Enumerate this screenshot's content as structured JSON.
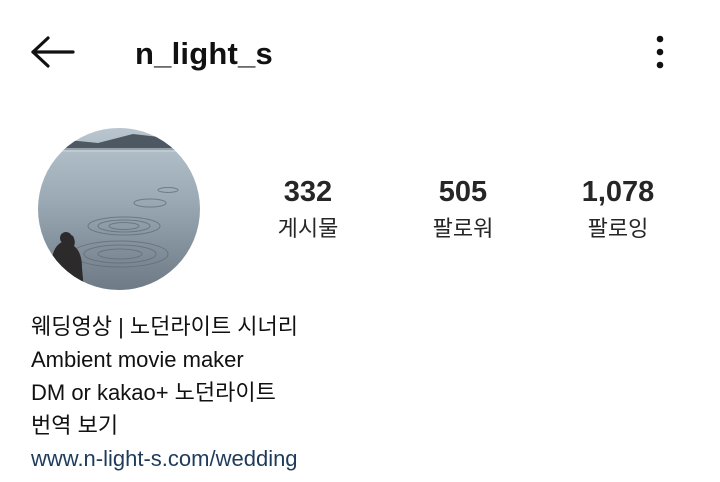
{
  "header": {
    "username": "n_light_s",
    "back_icon": "arrow-left-icon",
    "more_icon": "more-vertical-icon"
  },
  "stats": [
    {
      "value": "332",
      "label": "게시물"
    },
    {
      "value": "505",
      "label": "팔로워"
    },
    {
      "value": "1,078",
      "label": "팔로잉"
    }
  ],
  "bio": {
    "lines": [
      "웨딩영상 | 노던라이트 시너리",
      "Ambient movie maker",
      "DM or kakao+ 노던라이트"
    ],
    "translate": "번역 보기",
    "link": "www.n-light-s.com/wedding"
  },
  "colors": {
    "link": "#1e3b5c",
    "text": "#111111"
  }
}
